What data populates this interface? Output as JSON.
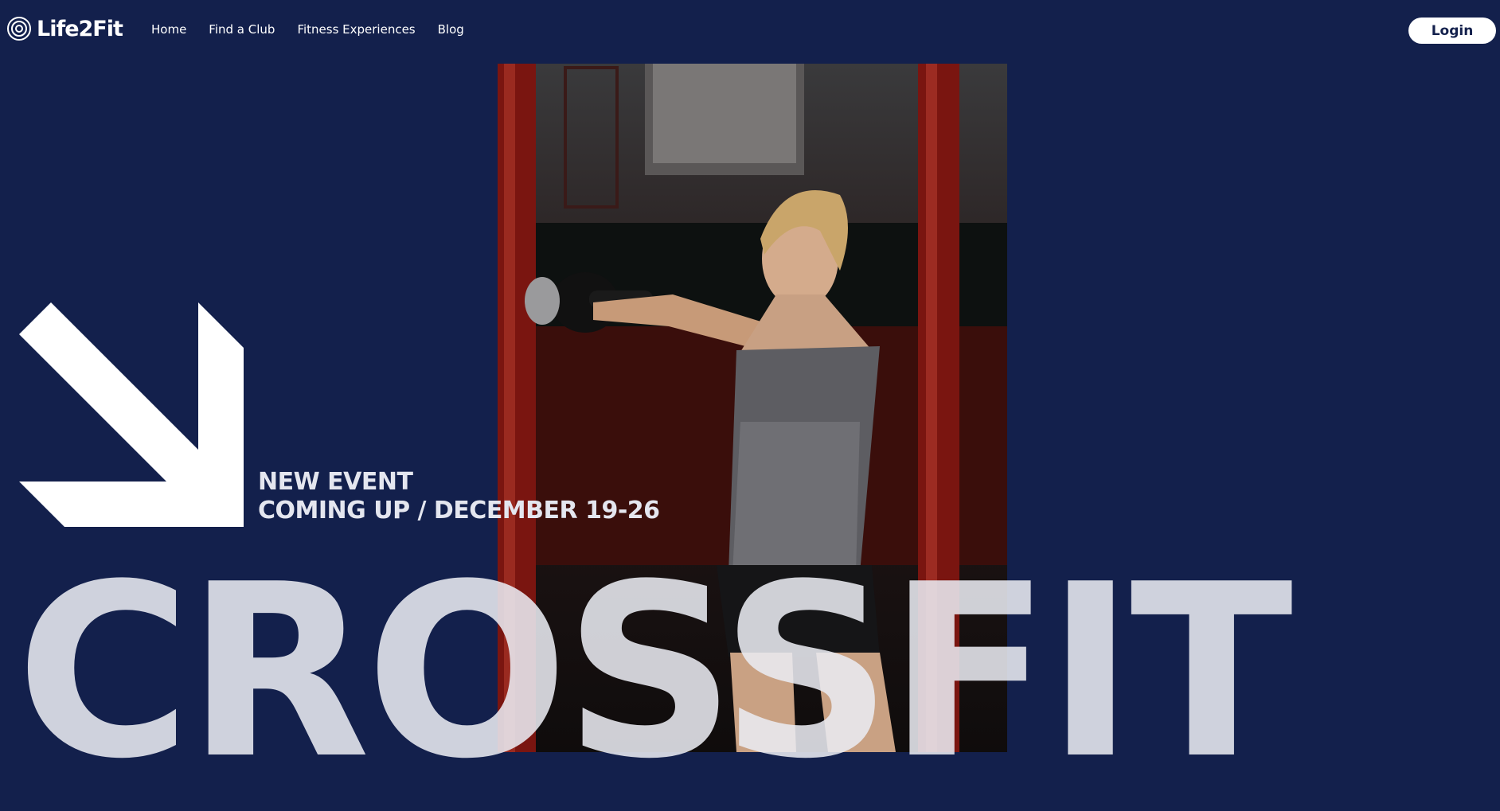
{
  "brand": {
    "name": "Life2Fit",
    "icon": "concentric-circle-logo-icon"
  },
  "nav": {
    "links": [
      "Home",
      "Find a Club",
      "Fitness Experiences",
      "Blog"
    ],
    "login_label": "Login"
  },
  "hero": {
    "event_line1": "NEW EVENT",
    "event_line2": "COMING UP / DECEMBER 19-26",
    "headline": "CROSSFIT",
    "arrow_icon": "arrow-down-right-icon",
    "photo": "woman-kettlebell-photo"
  },
  "colors": {
    "background": "#13204c",
    "text_light": "#e4e6ef",
    "accent_red": "#8a1a14",
    "button_bg": "#ffffff"
  }
}
